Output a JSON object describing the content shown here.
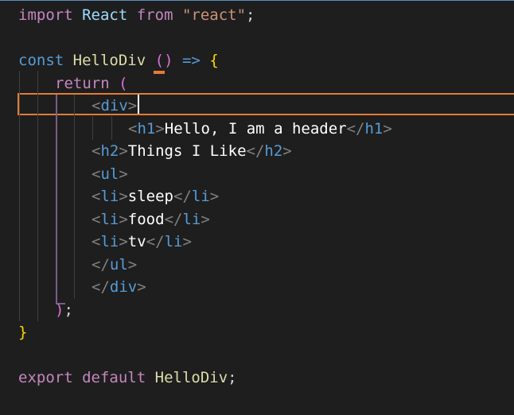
{
  "code": {
    "lines": [
      {
        "tokens": [
          [
            "import",
            "t-kw"
          ],
          [
            " ",
            "t-punc"
          ],
          [
            "React",
            "t-var"
          ],
          [
            " ",
            "t-punc"
          ],
          [
            "from",
            "t-kw"
          ],
          [
            " ",
            "t-punc"
          ],
          [
            "\"react\"",
            "t-str"
          ],
          [
            ";",
            "t-punc"
          ]
        ]
      },
      {
        "tokens": []
      },
      {
        "tokens": [
          [
            "const",
            "t-sk"
          ],
          [
            " ",
            "t-punc"
          ],
          [
            "HelloDiv",
            "t-fn"
          ],
          [
            " ",
            "t-punc"
          ],
          [
            "(",
            "t-paren2"
          ],
          [
            ")",
            "t-paren2"
          ],
          [
            " ",
            "t-punc"
          ],
          [
            "=>",
            "t-sk"
          ],
          [
            " ",
            "t-punc"
          ],
          [
            "{",
            "t-brace"
          ]
        ]
      },
      {
        "tokens": [
          [
            "return",
            "t-kw"
          ],
          [
            " ",
            "t-punc"
          ],
          [
            "(",
            "t-paren2"
          ]
        ]
      },
      {
        "tokens": [
          [
            "<",
            "t-br"
          ],
          [
            "div",
            "t-tag"
          ],
          [
            ">",
            "t-br"
          ]
        ]
      },
      {
        "tokens": [
          [
            "<",
            "t-br"
          ],
          [
            "h1",
            "t-tag"
          ],
          [
            ">",
            "t-br"
          ],
          [
            "Hello, I am a header",
            "t-text"
          ],
          [
            "</",
            "t-br"
          ],
          [
            "h1",
            "t-tag"
          ],
          [
            ">",
            "t-br"
          ]
        ]
      },
      {
        "tokens": [
          [
            "<",
            "t-br"
          ],
          [
            "h2",
            "t-tag"
          ],
          [
            ">",
            "t-br"
          ],
          [
            "Things I Like",
            "t-text"
          ],
          [
            "</",
            "t-br"
          ],
          [
            "h2",
            "t-tag"
          ],
          [
            ">",
            "t-br"
          ]
        ]
      },
      {
        "tokens": [
          [
            "<",
            "t-br"
          ],
          [
            "ul",
            "t-tag"
          ],
          [
            ">",
            "t-br"
          ]
        ]
      },
      {
        "tokens": [
          [
            "<",
            "t-br"
          ],
          [
            "li",
            "t-tag"
          ],
          [
            ">",
            "t-br"
          ],
          [
            "sleep",
            "t-text"
          ],
          [
            "</",
            "t-br"
          ],
          [
            "li",
            "t-tag"
          ],
          [
            ">",
            "t-br"
          ]
        ]
      },
      {
        "tokens": [
          [
            "<",
            "t-br"
          ],
          [
            "li",
            "t-tag"
          ],
          [
            ">",
            "t-br"
          ],
          [
            "food",
            "t-text"
          ],
          [
            "</",
            "t-br"
          ],
          [
            "li",
            "t-tag"
          ],
          [
            ">",
            "t-br"
          ]
        ]
      },
      {
        "tokens": [
          [
            "<",
            "t-br"
          ],
          [
            "li",
            "t-tag"
          ],
          [
            ">",
            "t-br"
          ],
          [
            "tv",
            "t-text"
          ],
          [
            "</",
            "t-br"
          ],
          [
            "li",
            "t-tag"
          ],
          [
            ">",
            "t-br"
          ]
        ]
      },
      {
        "tokens": [
          [
            "</",
            "t-br"
          ],
          [
            "ul",
            "t-tag"
          ],
          [
            ">",
            "t-br"
          ]
        ]
      },
      {
        "tokens": [
          [
            "</",
            "t-br"
          ],
          [
            "div",
            "t-tag"
          ],
          [
            ">",
            "t-br"
          ]
        ]
      },
      {
        "tokens": [
          [
            ")",
            "t-paren2"
          ],
          [
            ";",
            "t-punc"
          ]
        ]
      },
      {
        "tokens": [
          [
            "}",
            "t-brace"
          ]
        ]
      },
      {
        "tokens": []
      },
      {
        "tokens": [
          [
            "export",
            "t-kw"
          ],
          [
            " ",
            "t-punc"
          ],
          [
            "default",
            "t-kw"
          ],
          [
            " ",
            "t-punc"
          ],
          [
            "HelloDiv",
            "t-fn"
          ],
          [
            ";",
            "t-punc"
          ]
        ]
      }
    ],
    "cursor_line": 5,
    "cursor_column": 6
  },
  "colors": {
    "background": "#1e1e1e",
    "current_line_border": "#e27c38",
    "keyword": "#c586c0",
    "storage": "#569cd6",
    "variable": "#9cdcfe",
    "function": "#dcdcaa",
    "string": "#ce9178",
    "jsx_text": "#ffffff"
  }
}
